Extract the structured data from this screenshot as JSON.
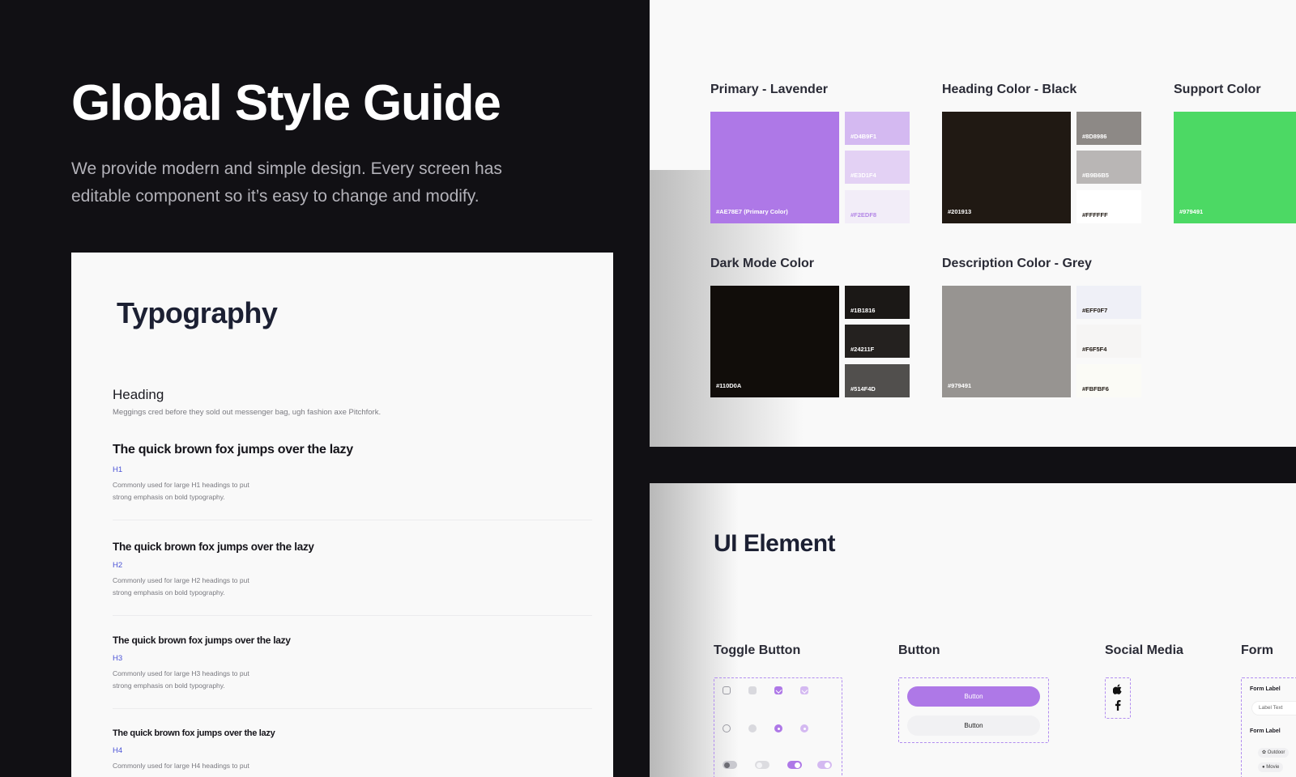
{
  "hero": {
    "title": "Global Style Guide",
    "description": "We provide modern and simple design. Every screen has editable component so it’s easy to change and modify."
  },
  "typography": {
    "title": "Typography",
    "heading": "Heading",
    "heading_sub": "Meggings cred before they sold out messenger bag, ugh fashion axe Pitchfork.",
    "rows": [
      {
        "sample": "The quick brown fox jumps over the lazy",
        "level": "H1",
        "desc1": "Commonly used for large H1 headings to put",
        "desc2": "strong emphasis on bold typography."
      },
      {
        "sample": "The quick brown fox jumps over the lazy",
        "level": "H2",
        "desc1": "Commonly used for large H2 headings to put",
        "desc2": "strong emphasis on bold typography."
      },
      {
        "sample": "The quick brown fox jumps over the lazy",
        "level": "H3",
        "desc1": "Commonly used for large H3 headings to put",
        "desc2": "strong emphasis on bold typography."
      },
      {
        "sample": "The quick brown fox jumps over the lazy",
        "level": "H4",
        "desc1": "Commonly used for large H4 headings to put",
        "desc2": ""
      }
    ]
  },
  "colors": {
    "groups": [
      {
        "title": "Primary - Lavender",
        "main": {
          "hex": "#AE78E7 (Primary Color)",
          "color": "#AE78E7",
          "text_color": "#ffffff"
        },
        "swatches": [
          {
            "hex": "#D4B9F1",
            "color": "#D4B9F1",
            "text_color": "#ffffff"
          },
          {
            "hex": "#E3D1F4",
            "color": "#E3D1F4",
            "text_color": "#ffffff"
          },
          {
            "hex": "#F2EDF8",
            "color": "#F2EDF8",
            "text_color": "#b487e6"
          }
        ]
      },
      {
        "title": "Heading Color - Black",
        "main": {
          "hex": "#201913",
          "color": "#201913",
          "text_color": "#ffffff"
        },
        "swatches": [
          {
            "hex": "#8D8986",
            "color": "#8D8986",
            "text_color": "#ffffff"
          },
          {
            "hex": "#B9B6B5",
            "color": "#B9B6B5",
            "text_color": "#ffffff"
          },
          {
            "hex": "#FFFFFF",
            "color": "#FFFFFF",
            "text_color": "#201913"
          }
        ]
      },
      {
        "title": "Support Color",
        "main": {
          "hex": "#979491",
          "color": "#4CD964",
          "text_color": "#ffffff"
        },
        "swatches": []
      },
      {
        "title": "Dark Mode Color",
        "main": {
          "hex": "#110D0A",
          "color": "#110D0A",
          "text_color": "#ffffff"
        },
        "swatches": [
          {
            "hex": "#1B1816",
            "color": "#1B1816",
            "text_color": "#ffffff"
          },
          {
            "hex": "#24211F",
            "color": "#24211F",
            "text_color": "#ffffff"
          },
          {
            "hex": "#514F4D",
            "color": "#514F4D",
            "text_color": "#ffffff"
          }
        ]
      },
      {
        "title": "Description Color - Grey",
        "main": {
          "hex": "#979491",
          "color": "#979491",
          "text_color": "#ffffff"
        },
        "swatches": [
          {
            "hex": "#EFF0F7",
            "color": "#EFF0F7",
            "text_color": "#201913"
          },
          {
            "hex": "#F6F5F4",
            "color": "#F6F5F4",
            "text_color": "#201913"
          },
          {
            "hex": "#FBFBF6",
            "color": "#FBFBF6",
            "text_color": "#201913"
          }
        ]
      }
    ]
  },
  "ui_element": {
    "title": "UI Element",
    "toggle_title": "Toggle Button",
    "button_title": "Button",
    "primary_button": "Button",
    "secondary_button": "Button",
    "social_title": "Social Media",
    "social_icons": [
      "apple-icon",
      "facebook-icon"
    ],
    "form_title": "Form",
    "form_label_1": "Form Label",
    "form_input": "Label Text",
    "form_label_2": "Form Label",
    "chip_1": "Outdoor",
    "chip_2": "Movie"
  }
}
